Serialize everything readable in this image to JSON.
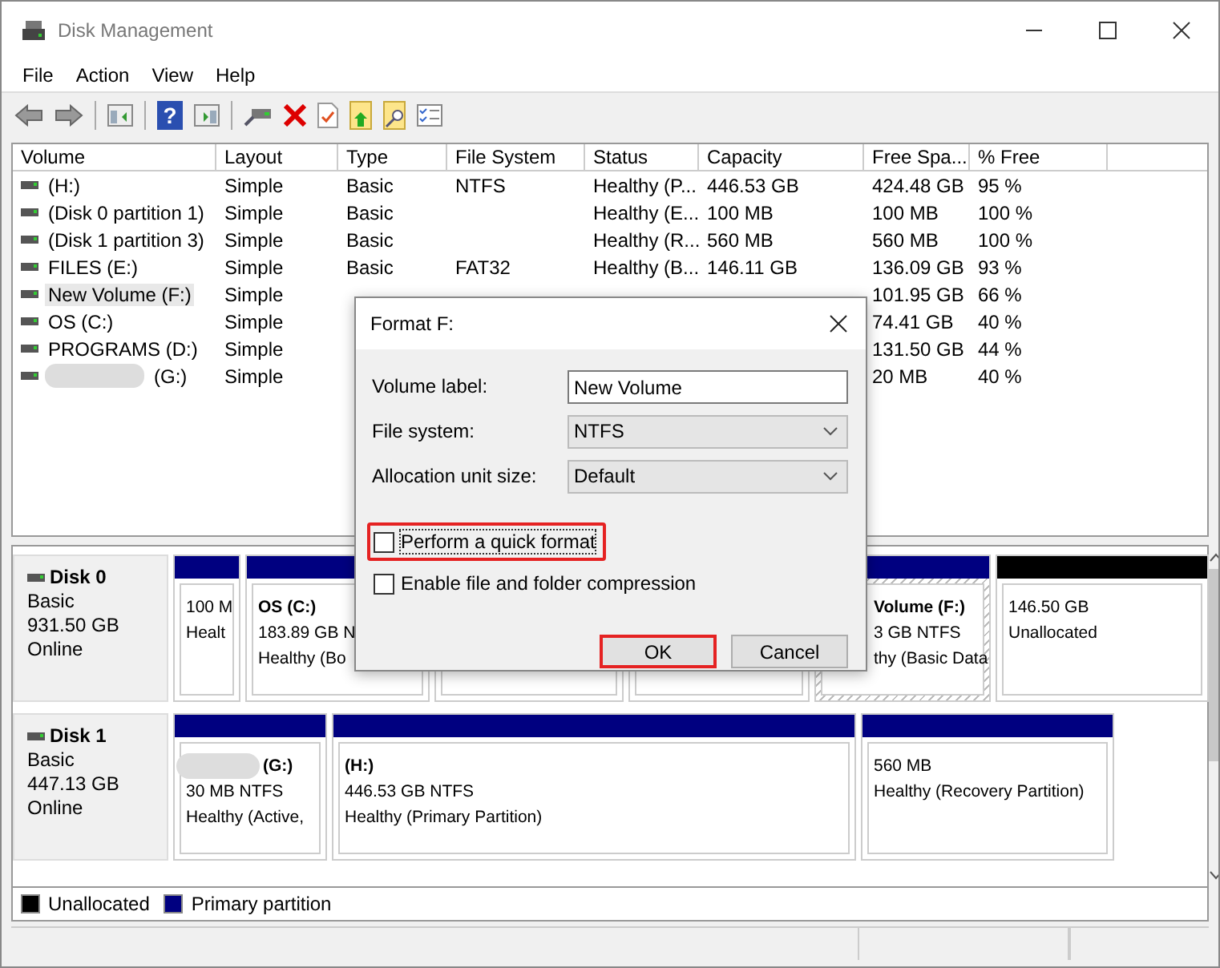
{
  "window": {
    "title": "Disk Management"
  },
  "menu": [
    "File",
    "Action",
    "View",
    "Help"
  ],
  "toolbar": {
    "help_glyph": "?"
  },
  "volume_table": {
    "columns": [
      "Volume",
      "Layout",
      "Type",
      "File System",
      "Status",
      "Capacity",
      "Free Spa...",
      "% Free"
    ],
    "rows": [
      {
        "volume": "(H:)",
        "layout": "Simple",
        "type": "Basic",
        "file_system": "NTFS",
        "status": "Healthy (P...",
        "capacity": "446.53 GB",
        "free_space": "424.48 GB",
        "percent_free": "95 %",
        "selected": false
      },
      {
        "volume": "(Disk 0 partition 1)",
        "layout": "Simple",
        "type": "Basic",
        "status": "Healthy (E...",
        "capacity": "100 MB",
        "free_space": "100 MB",
        "percent_free": "100 %",
        "selected": false
      },
      {
        "volume": "(Disk 1 partition 3)",
        "layout": "Simple",
        "type": "Basic",
        "status": "Healthy (R...",
        "capacity": "560 MB",
        "free_space": "560 MB",
        "percent_free": "100 %",
        "selected": false
      },
      {
        "volume": "FILES (E:)",
        "layout": "Simple",
        "type": "Basic",
        "file_system": "FAT32",
        "status": "Healthy (B...",
        "capacity": "146.11 GB",
        "free_space": "136.09 GB",
        "percent_free": "93 %",
        "selected": false
      },
      {
        "volume": "New Volume (F:)",
        "layout": "Simple",
        "free_space": "101.95 GB",
        "percent_free": "66 %",
        "selected": true
      },
      {
        "volume": "OS (C:)",
        "layout": "Simple",
        "free_space": "74.41 GB",
        "percent_free": "40 %",
        "selected": false
      },
      {
        "volume": "PROGRAMS (D:)",
        "layout": "Simple",
        "free_space": "131.50 GB",
        "percent_free": "44 %",
        "selected": false
      },
      {
        "volume": "(G:)",
        "layout": "Simple",
        "free_space": "20 MB",
        "percent_free": "40 %",
        "selected": false,
        "blurred": true
      }
    ]
  },
  "disks": [
    {
      "name": "Disk 0",
      "type": "Basic",
      "size": "931.50 GB",
      "status": "Online",
      "partitions": [
        {
          "kind": "primary",
          "size": "100 M",
          "status": "Healt",
          "selected": false
        },
        {
          "kind": "primary",
          "label": "OS  (C:)",
          "size": "183.89 GB N",
          "status": "Healthy (Bo",
          "selected": false
        },
        {
          "kind": "primary",
          "selected": false
        },
        {
          "kind": "primary",
          "selected": false
        },
        {
          "kind": "primary",
          "label": "Volume  (F:)",
          "size": "3 GB NTFS",
          "status": "thy (Basic Data",
          "selected": true
        },
        {
          "kind": "unallocated",
          "size": "146.50 GB",
          "status": "Unallocated",
          "selected": false
        }
      ]
    },
    {
      "name": "Disk 1",
      "type": "Basic",
      "size": "447.13 GB",
      "status": "Online",
      "partitions": [
        {
          "kind": "primary",
          "label": "(G:)",
          "size": "30 MB NTFS",
          "status": "Healthy (Active,",
          "selected": false,
          "blurred": true
        },
        {
          "kind": "primary",
          "label": "(H:)",
          "size": "446.53 GB NTFS",
          "status": "Healthy (Primary Partition)",
          "selected": false
        },
        {
          "kind": "primary",
          "size": "560 MB",
          "status": "Healthy (Recovery Partition)",
          "selected": false
        }
      ]
    }
  ],
  "legend": [
    {
      "label": "Unallocated",
      "color": "#000000"
    },
    {
      "label": "Primary partition",
      "color": "#000080"
    }
  ],
  "dialog": {
    "title": "Format F:",
    "fields": [
      {
        "kind": "text",
        "label": "Volume label:",
        "value": "New Volume"
      },
      {
        "kind": "select",
        "label": "File system:",
        "value": "NTFS"
      },
      {
        "kind": "select",
        "label": "Allocation unit size:",
        "value": "Default"
      }
    ],
    "options": [
      {
        "label": "Perform a quick format",
        "checked": false,
        "highlighted": true
      },
      {
        "label": "Enable file and folder compression",
        "checked": false,
        "highlighted": false
      }
    ],
    "buttons": [
      {
        "label": "OK",
        "highlighted": true
      },
      {
        "label": "Cancel",
        "highlighted": false
      }
    ]
  }
}
